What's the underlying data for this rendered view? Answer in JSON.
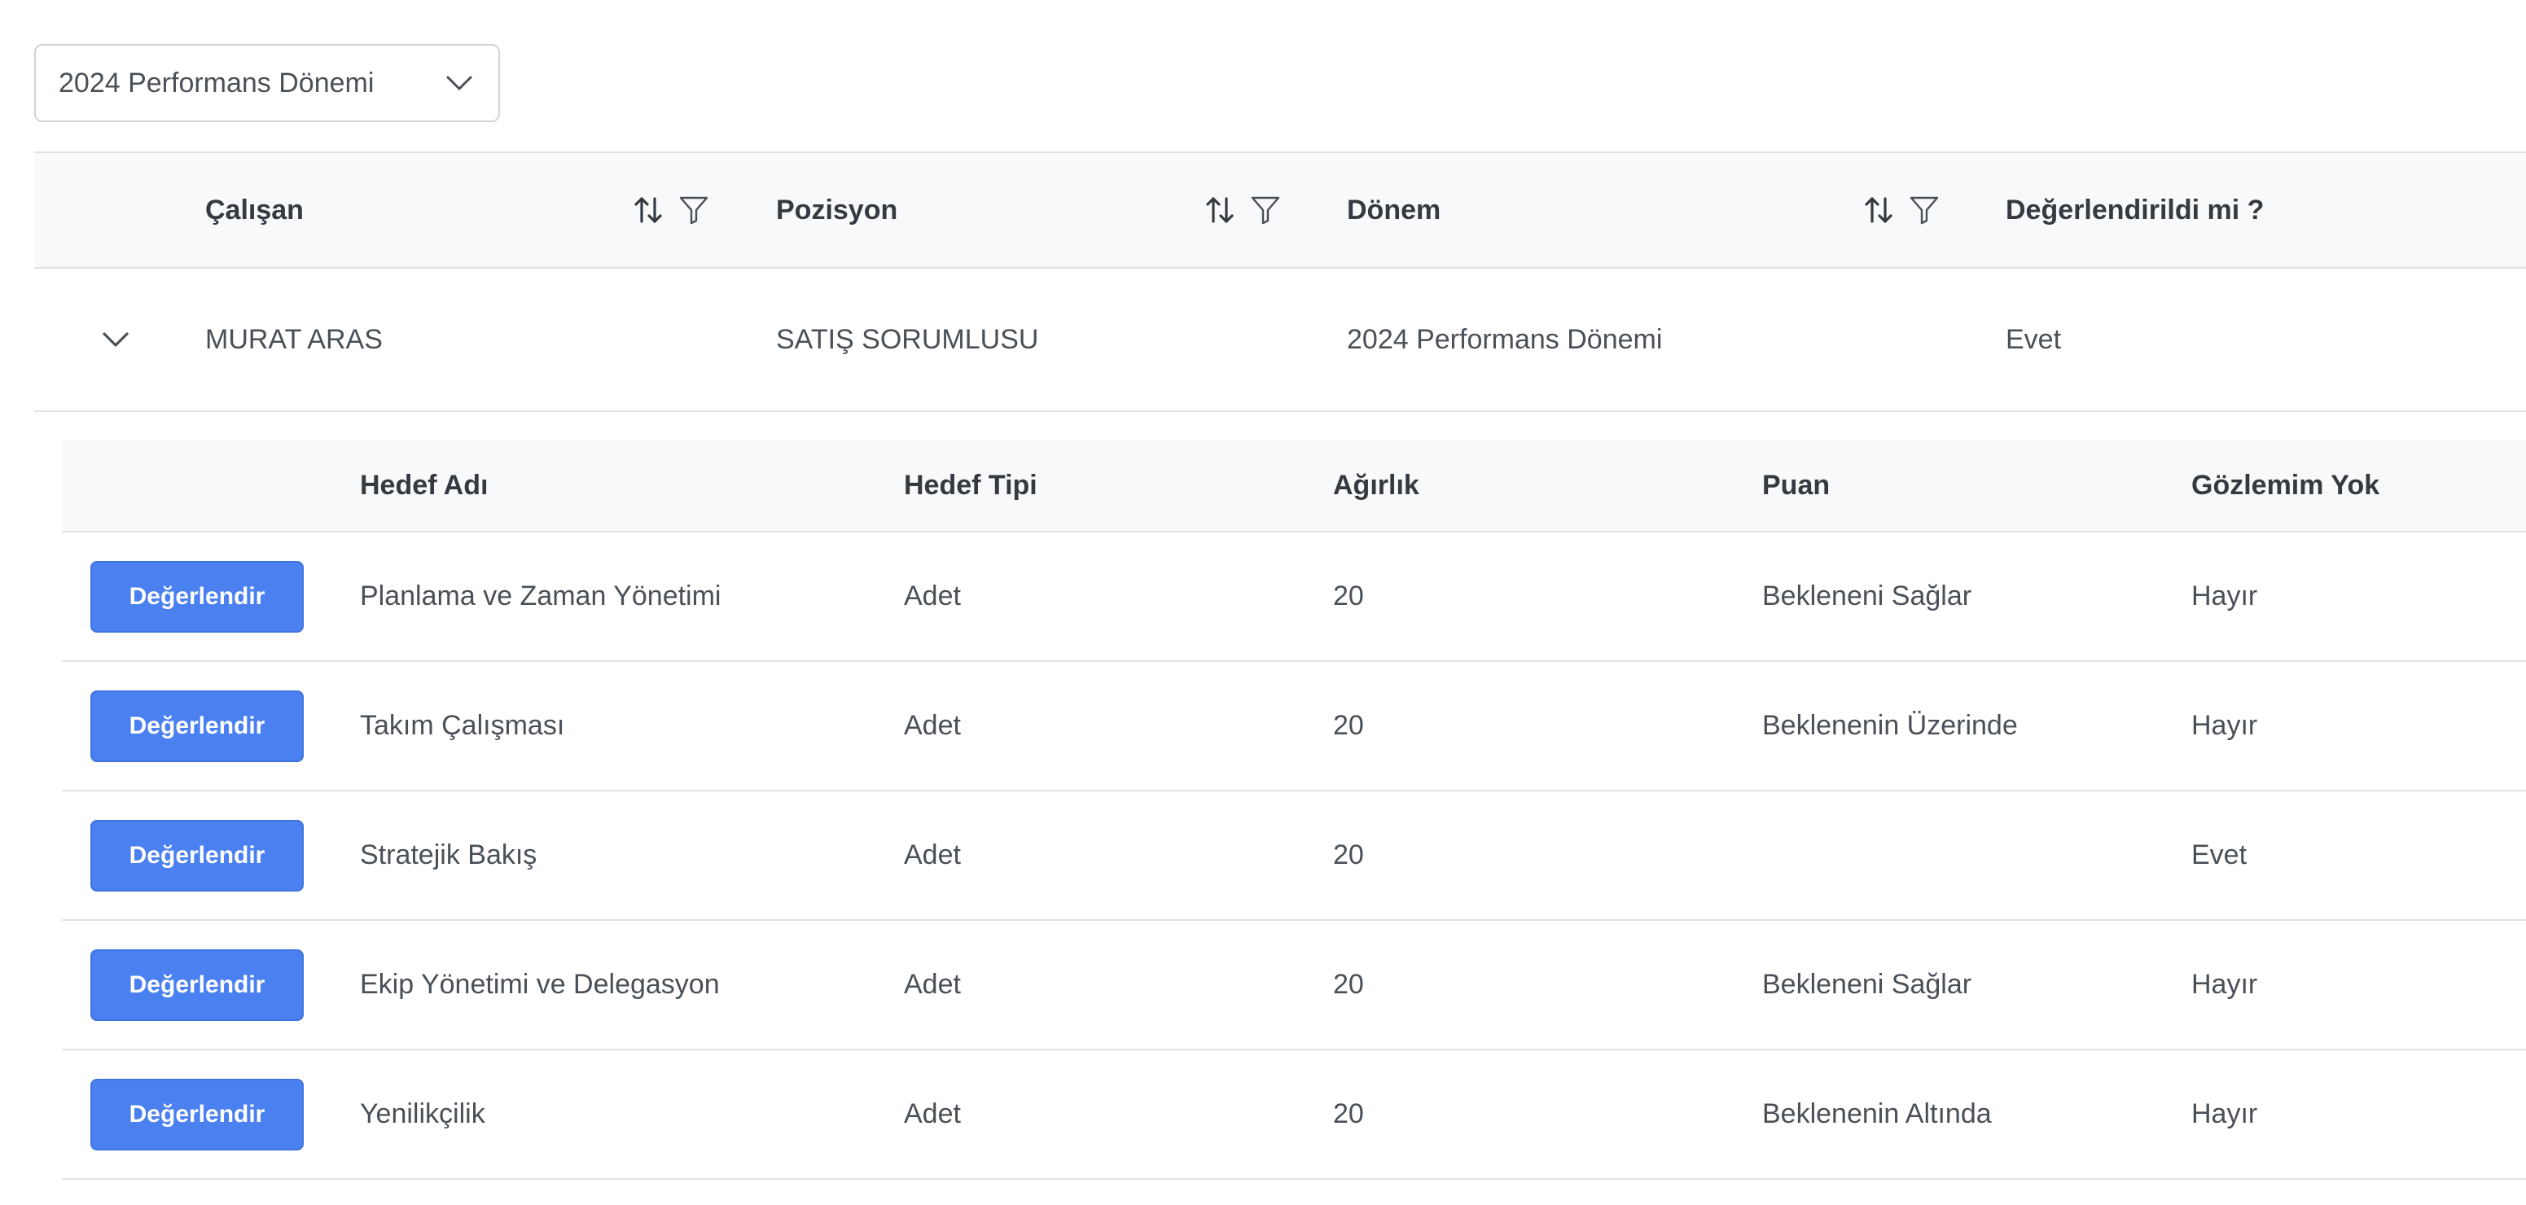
{
  "period_select": {
    "value": "2024 Performans Dönemi",
    "icon": "chevron-down-icon"
  },
  "main_table": {
    "columns": [
      {
        "label": "Çalışan",
        "sortable": true,
        "filterable": true
      },
      {
        "label": "Pozisyon",
        "sortable": true,
        "filterable": true
      },
      {
        "label": "Dönem",
        "sortable": true,
        "filterable": true
      },
      {
        "label": "Değerlendirildi mi ?",
        "sortable": false,
        "filterable": false
      }
    ],
    "rows": [
      {
        "employee": "MURAT ARAS",
        "position": "SATIŞ SORUMLUSU",
        "period": "2024 Performans Dönemi",
        "evaluated": "Evet",
        "expanded": true
      }
    ]
  },
  "sub_table": {
    "columns": [
      "Hedef Adı",
      "Hedef Tipi",
      "Ağırlık",
      "Puan",
      "Gözlemim Yok"
    ],
    "action_label": "Değerlendir",
    "rows": [
      {
        "goal": "Planlama ve Zaman Yönetimi",
        "type": "Adet",
        "weight": "20",
        "score": "Bekleneni Sağlar",
        "no_observation": "Hayır"
      },
      {
        "goal": "Takım Çalışması",
        "type": "Adet",
        "weight": "20",
        "score": "Beklenenin Üzerinde",
        "no_observation": "Hayır"
      },
      {
        "goal": "Stratejik Bakış",
        "type": "Adet",
        "weight": "20",
        "score": "",
        "no_observation": "Evet"
      },
      {
        "goal": "Ekip Yönetimi ve Delegasyon",
        "type": "Adet",
        "weight": "20",
        "score": "Bekleneni Sağlar",
        "no_observation": "Hayır"
      },
      {
        "goal": "Yenilikçilik",
        "type": "Adet",
        "weight": "20",
        "score": "Beklenenin Altında",
        "no_observation": "Hayır"
      }
    ]
  },
  "colors": {
    "primary": "#4a80ef",
    "header_bg": "#f8f9fa",
    "border": "#dee2e6",
    "text": "#495057"
  }
}
